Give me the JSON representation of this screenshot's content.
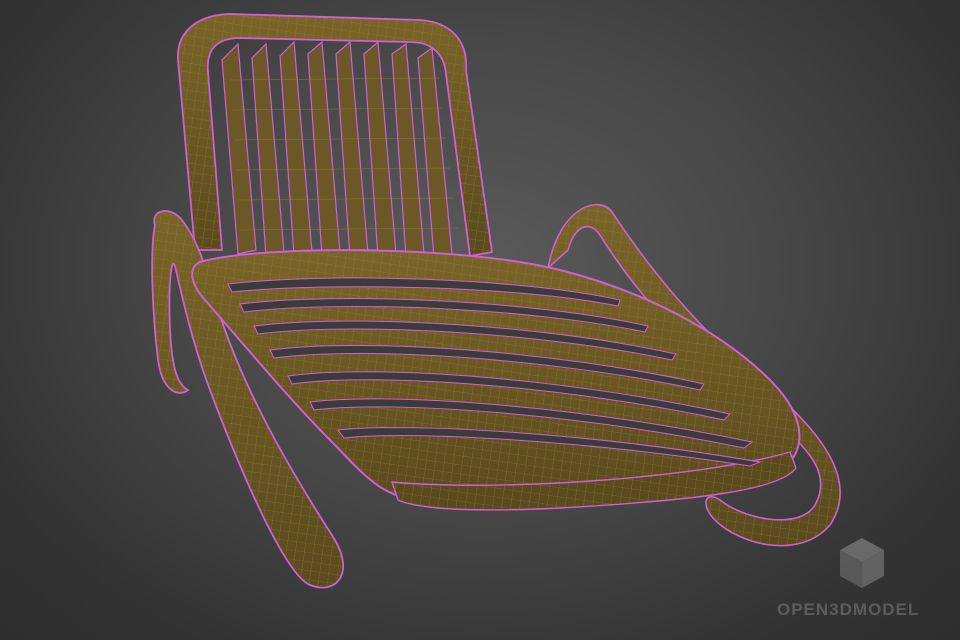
{
  "scene": {
    "subject": "",
    "colors": {
      "background_center": "#5a5a5a",
      "background_edge": "#2e2e2e",
      "surface_fill": "#6b5826",
      "surface_dark": "#4a3c18",
      "wire_magenta": "#d05fd8",
      "wire_olive": "#8f8a3a"
    }
  },
  "watermark": {
    "text": "OPEN3DMODEL",
    "icon": "cube-icon"
  }
}
